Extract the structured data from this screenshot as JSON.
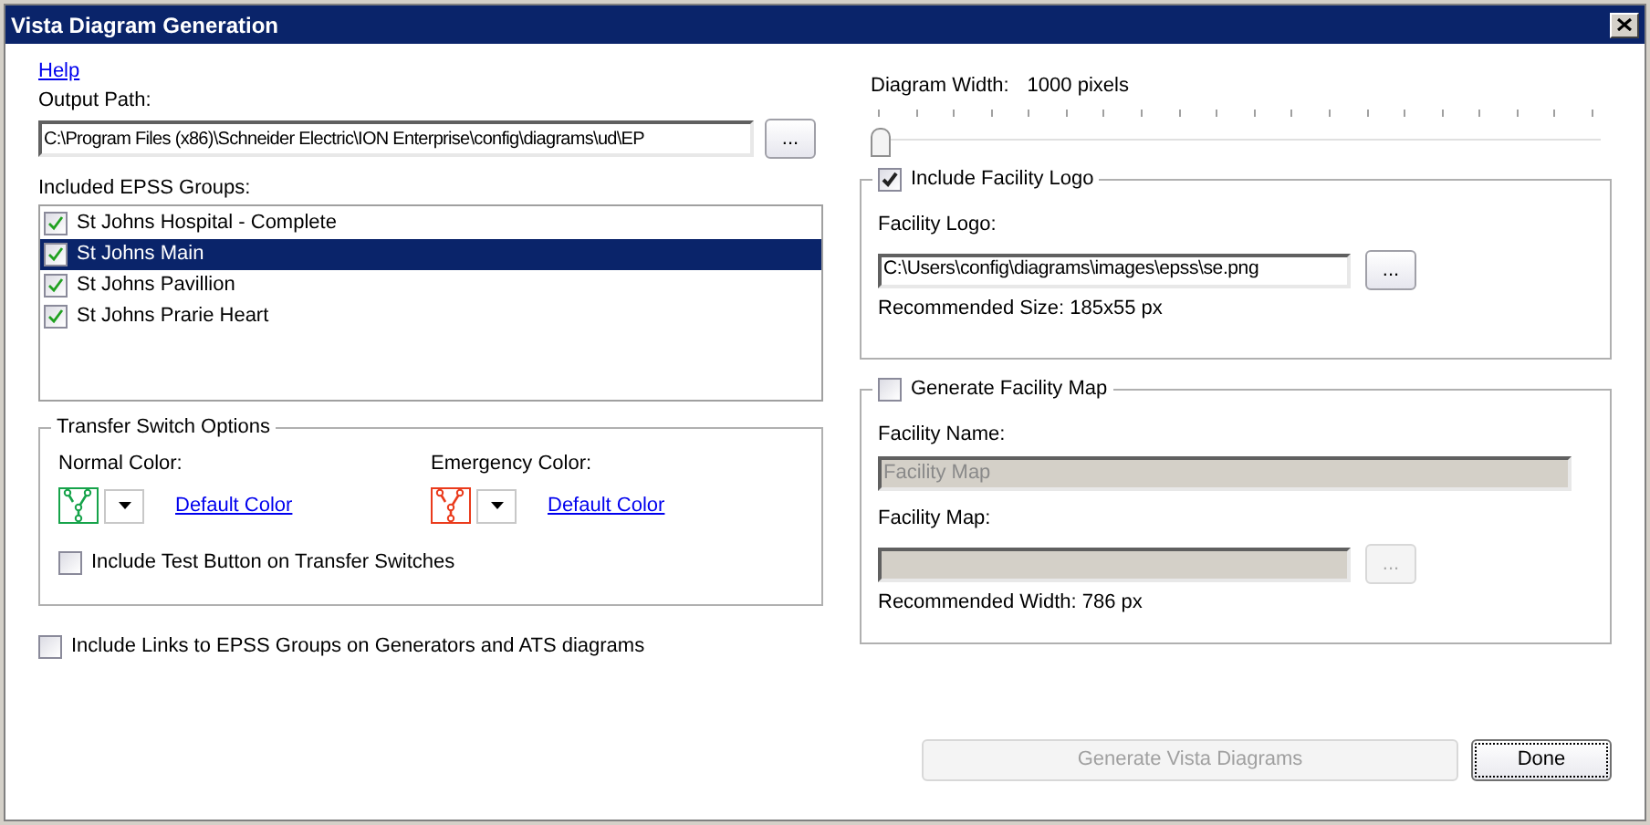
{
  "window": {
    "title": "Vista Diagram Generation"
  },
  "help_link": "Help",
  "output_path": {
    "label": "Output Path:",
    "value": "C:\\Program Files (x86)\\Schneider Electric\\ION Enterprise\\config\\diagrams\\ud\\EP",
    "browse": "..."
  },
  "groups": {
    "label": "Included EPSS Groups:",
    "items": [
      {
        "label": "St Johns Hospital - Complete",
        "checked": true,
        "selected": false
      },
      {
        "label": "St Johns Main",
        "checked": true,
        "selected": true
      },
      {
        "label": "St Johns Pavillion",
        "checked": true,
        "selected": false
      },
      {
        "label": "St Johns Prarie Heart",
        "checked": true,
        "selected": false
      }
    ]
  },
  "transfer_switch": {
    "title": "Transfer Switch Options",
    "colors": [
      {
        "label": "Normal Color:",
        "color": "#16a34a",
        "link": "Default Color"
      },
      {
        "label": "Emergency Color:",
        "color": "#ea3b1c",
        "link": "Default Color"
      }
    ],
    "test_button": {
      "label": "Include Test Button on Transfer Switches",
      "checked": false
    }
  },
  "include_links": {
    "label": "Include Links to EPSS Groups on Generators and ATS diagrams",
    "checked": false
  },
  "diagram_width": {
    "label": "Diagram Width:",
    "reading": "1000 pixels",
    "level": 0
  },
  "facility_logo": {
    "label": "Include Facility Logo",
    "checked": true,
    "field_label": "Facility Logo:",
    "value": "C:\\Users\\config\\diagrams\\images\\epss\\se.png",
    "browse": "...",
    "note": "Recommended Size: 185x55 px"
  },
  "facility_map": {
    "label": "Generate Facility Map",
    "checked": false,
    "name_label": "Facility Name:",
    "name_value": "Facility Map",
    "map_label": "Facility Map:",
    "browse": "...",
    "note": "Recommended Width: 786 px"
  },
  "buttons": [
    {
      "label": "Generate Vista Diagrams",
      "disabled": true,
      "focused": false
    },
    {
      "label": "Done",
      "disabled": false,
      "focused": true
    }
  ]
}
